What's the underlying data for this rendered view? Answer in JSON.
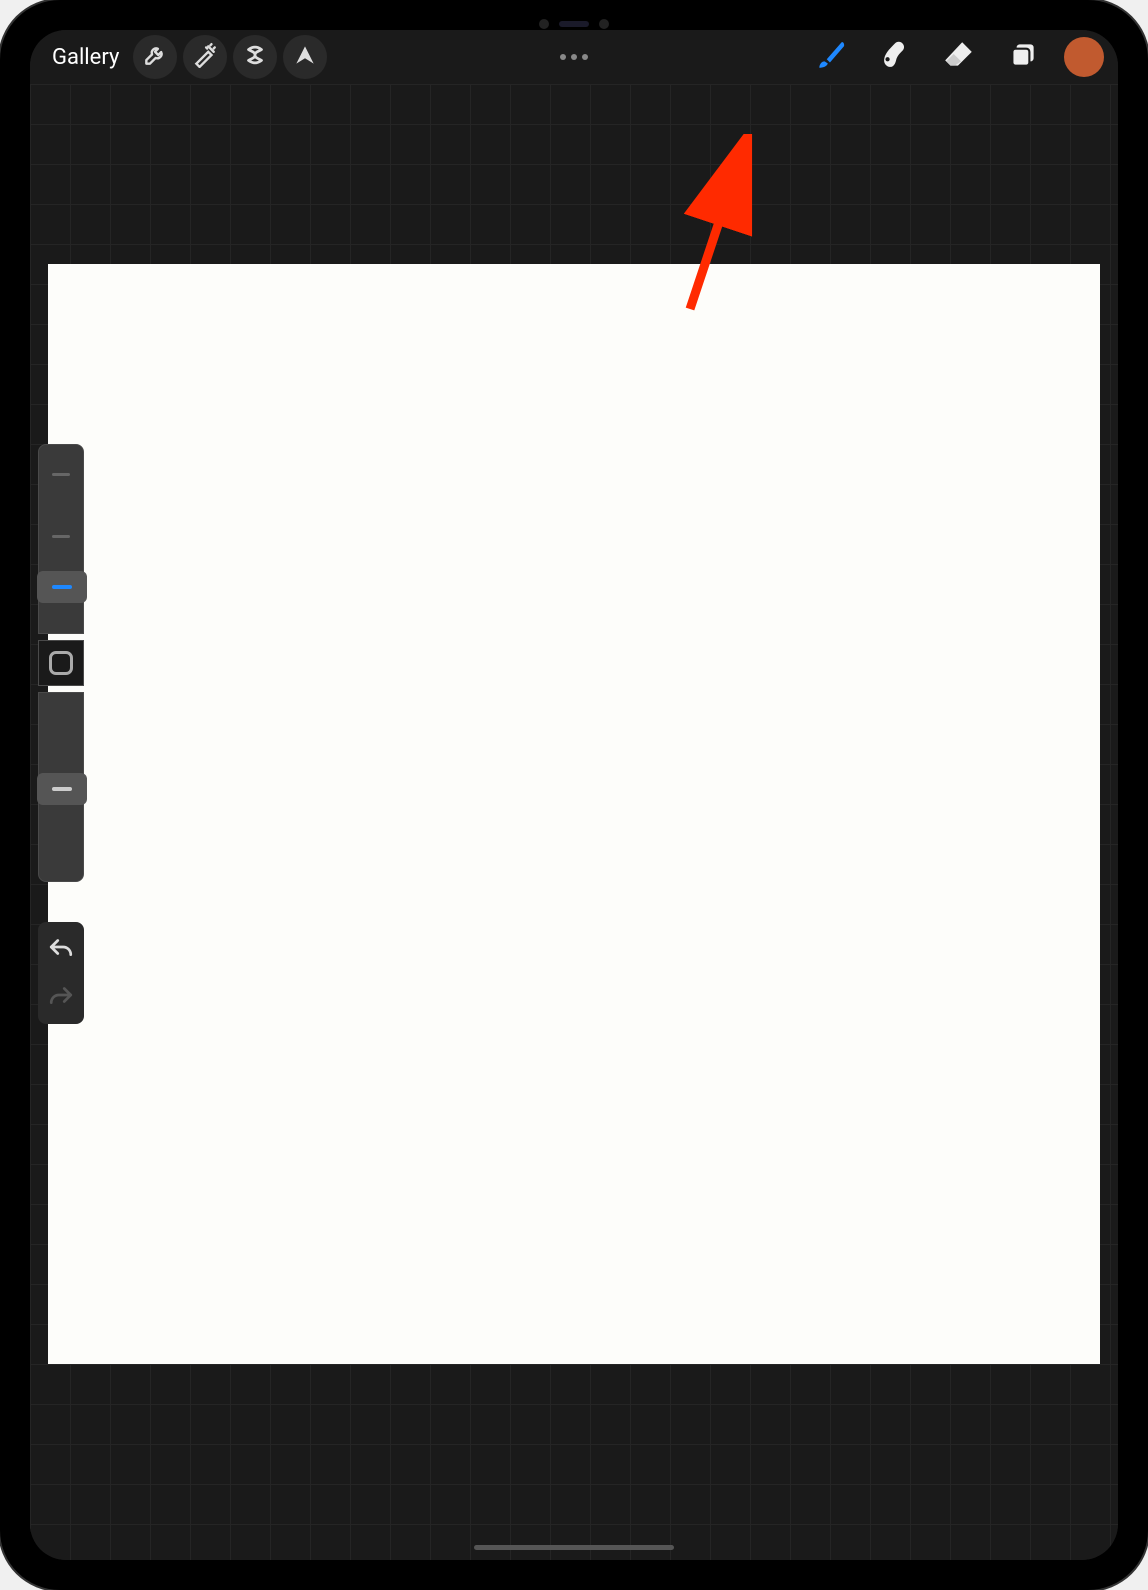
{
  "toolbar": {
    "gallery_label": "Gallery",
    "actions_icon": "wrench",
    "adjustments_icon": "wand",
    "selection_icon": "s-ribbon",
    "transform_icon": "arrow-cursor",
    "modify_icon": "dots"
  },
  "tools": {
    "brush_icon": "brush",
    "brush_active": true,
    "smudge_icon": "smudge",
    "eraser_icon": "eraser",
    "layers_icon": "layers",
    "color_hex": "#c15a2f"
  },
  "sidebar": {
    "size_slider_value": 80,
    "opacity_slider_value": 55,
    "modifier_icon": "square",
    "undo_icon": "undo",
    "redo_icon": "redo"
  },
  "annotation": {
    "color": "#ff2a00",
    "target": "eraser-tool"
  },
  "canvas": {
    "background": "#fdfdfa"
  }
}
